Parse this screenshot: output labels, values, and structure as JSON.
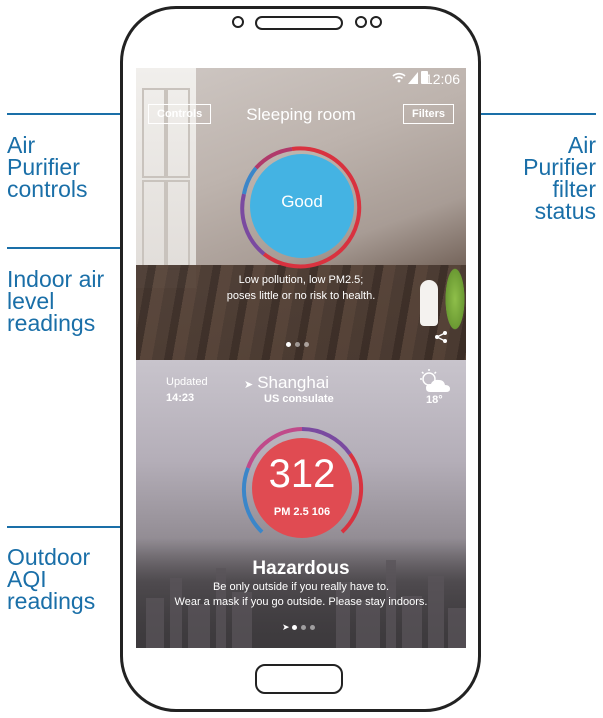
{
  "callouts": {
    "controls": "Air\nPurifier\ncontrols",
    "filter": "Air\nPurifier\nfilter\nstatus",
    "indoor": "Indoor air\nlevel\nreadings",
    "outdoor": "Outdoor\nAQI\nreadings"
  },
  "status_bar": {
    "time": "12:06",
    "wifi_icon": "wifi-icon",
    "signal_icon": "signal-icon",
    "battery_icon": "battery-icon"
  },
  "indoor": {
    "room": "Sleeping room",
    "controls_label": "Controls",
    "filters_label": "Filters",
    "status": "Good",
    "description_line1": "Low pollution, low PM2.5;",
    "description_line2": "poses little or no risk to health.",
    "page_count": 3,
    "active_page": 1,
    "share_icon": "share-icon"
  },
  "outdoor": {
    "updated_label": "Updated",
    "updated_time": "14:23",
    "city": "Shanghai",
    "source": "US consulate",
    "temperature": "18°",
    "weather_icon": "partly-cloudy-icon",
    "aqi": "312",
    "pm_label": "PM 2.5 106",
    "level": "Hazardous",
    "description_line1": "Be only outside if you really have to.",
    "description_line2": "Wear a mask if you go outside. Please stay indoors."
  },
  "colors": {
    "accent": "#1a6fa8",
    "good": "#44b3e3",
    "hazardous": "#e04b52",
    "ring_red": "#d9323f",
    "ring_purple": "#7a4aa0",
    "ring_blue": "#3b86c9"
  }
}
